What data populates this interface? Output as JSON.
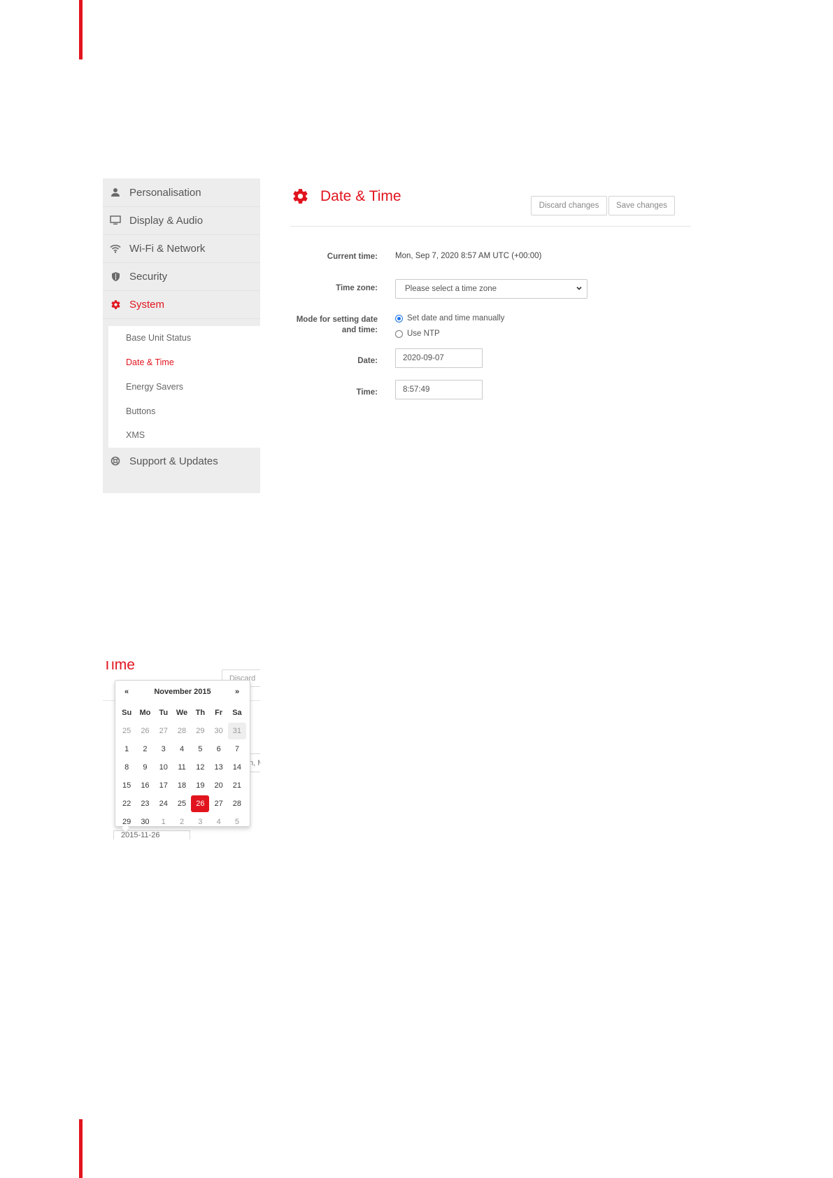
{
  "sidebar": {
    "items": [
      {
        "label": "Personalisation",
        "icon": "user-icon"
      },
      {
        "label": "Display & Audio",
        "icon": "monitor-icon"
      },
      {
        "label": "Wi-Fi & Network",
        "icon": "wifi-icon"
      },
      {
        "label": "Security",
        "icon": "shield-icon"
      },
      {
        "label": "System",
        "icon": "gear-icon"
      },
      {
        "label": "Support & Updates",
        "icon": "lifebuoy-icon"
      }
    ],
    "submenu": [
      {
        "label": "Base Unit Status"
      },
      {
        "label": "Date & Time"
      },
      {
        "label": "Energy Savers"
      },
      {
        "label": "Buttons"
      },
      {
        "label": "XMS"
      }
    ]
  },
  "header": {
    "title": "Date & Time",
    "discard_label": "Discard changes",
    "save_label": "Save changes"
  },
  "form": {
    "current_time_label": "Current time:",
    "current_time_value": "Mon, Sep 7, 2020 8:57 AM UTC (+00:00)",
    "time_zone_label": "Time zone:",
    "time_zone_placeholder": "Please select a time zone",
    "mode_label_1": "Mode for setting date",
    "mode_label_2": "and time:",
    "mode_manual_label": "Set date and time manually",
    "mode_ntp_label": "Use NTP",
    "date_label": "Date:",
    "date_value": "2020-09-07",
    "time_label": "Time:",
    "time_value": "8:57:49"
  },
  "datepicker": {
    "background_title": "Time",
    "background_button_fragment": "Discard",
    "background_field_fragment": "n, M",
    "background_date_fragment": "2015-11-26",
    "prev": "«",
    "next": "»",
    "month_label": "November 2015",
    "weekdays": [
      "Su",
      "Mo",
      "Tu",
      "We",
      "Th",
      "Fr",
      "Sa"
    ],
    "weeks": [
      [
        "25",
        "26",
        "27",
        "28",
        "29",
        "30",
        "31"
      ],
      [
        "1",
        "2",
        "3",
        "4",
        "5",
        "6",
        "7"
      ],
      [
        "8",
        "9",
        "10",
        "11",
        "12",
        "13",
        "14"
      ],
      [
        "15",
        "16",
        "17",
        "18",
        "19",
        "20",
        "21"
      ],
      [
        "22",
        "23",
        "24",
        "25",
        "26",
        "27",
        "28"
      ],
      [
        "29",
        "30",
        "1",
        "2",
        "3",
        "4",
        "5"
      ]
    ],
    "selected_day": "26",
    "colors": {
      "accent": "#e1141e"
    }
  }
}
